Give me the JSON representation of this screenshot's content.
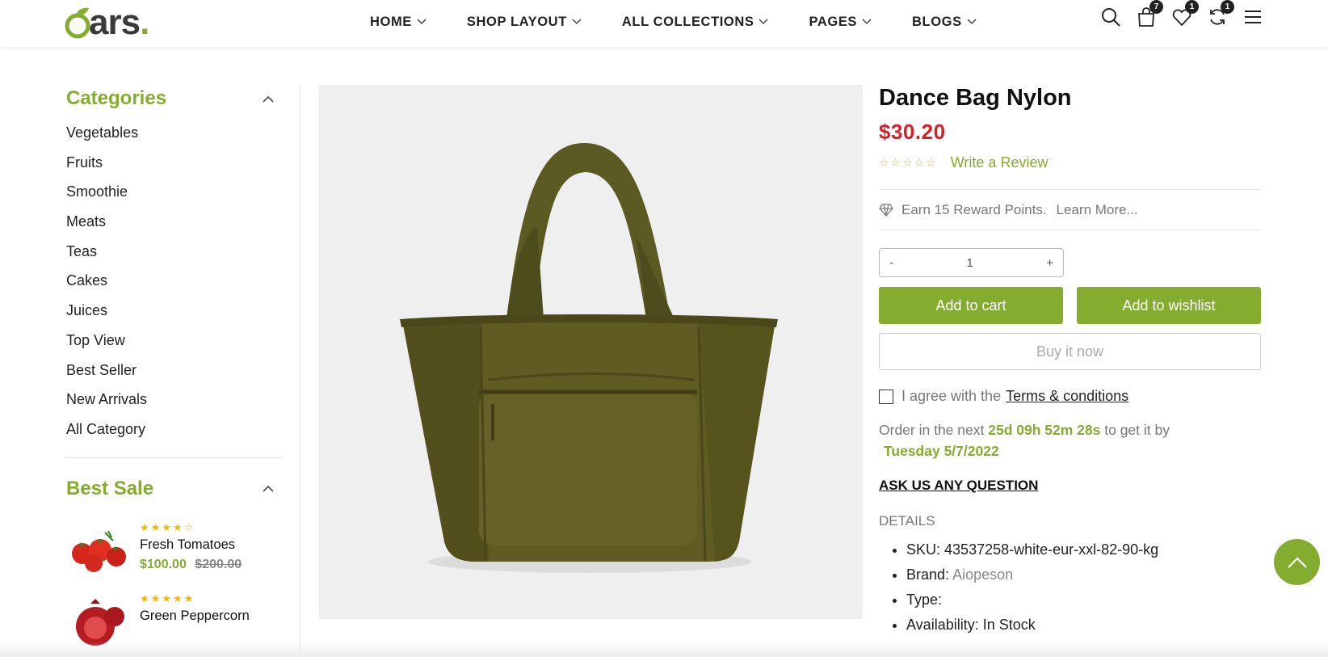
{
  "brand": {
    "logo_text": "ars",
    "logo_dot": ".",
    "accent": "#84ad2f"
  },
  "nav": [
    {
      "label": "HOME"
    },
    {
      "label": "SHOP LAYOUT"
    },
    {
      "label": "ALL COLLECTIONS"
    },
    {
      "label": "PAGES"
    },
    {
      "label": "BLOGS"
    }
  ],
  "header_icons": {
    "cart_count": "7",
    "wishlist_count": "1",
    "compare_count": "1"
  },
  "sidebar": {
    "categories_title": "Categories",
    "categories": [
      "Vegetables",
      "Fruits",
      "Smoothie",
      "Meats",
      "Teas",
      "Cakes",
      "Juices",
      "Top View",
      "Best Seller",
      "New Arrivals",
      "All Category"
    ],
    "best_sale_title": "Best Sale",
    "best_sale": [
      {
        "name": "Fresh Tomatoes",
        "stars": "★★★★☆",
        "rating": 4,
        "price": "$100.00",
        "old_price": "$200.00"
      },
      {
        "name": "Green Peppercorn",
        "stars": "★★★★★",
        "rating": 5
      }
    ]
  },
  "product": {
    "title": "Dance Bag Nylon",
    "price": "$30.20",
    "price_color": "#d91f26",
    "review_stars": "☆☆☆☆☆",
    "rating": 0,
    "review_link": "Write a Review",
    "reward_text": "Earn 15 Reward Points.",
    "learn_more": "Learn More...",
    "qty_minus": "-",
    "qty_value": "1",
    "qty_plus": "+",
    "add_to_cart": "Add to cart",
    "add_to_wishlist": "Add to wishlist",
    "buy_now": "Buy it now",
    "agree_text": "I agree with the",
    "terms_link": "Terms & conditions",
    "order_prefix": "Order in the next",
    "countdown": "25d 09h 52m 28s",
    "order_mid": "to get it by",
    "delivery_date": "Tuesday 5/7/2022",
    "ask_question": "ASK US ANY QUESTION",
    "details_heading": "DETAILS",
    "details": [
      {
        "label": "SKU:",
        "value": "43537258-white-eur-xxl-82-90-kg"
      },
      {
        "label": "Brand:",
        "value": "Aiopeson"
      },
      {
        "label": "Type:",
        "value": ""
      },
      {
        "label": "Availability:",
        "value": "In Stock"
      }
    ]
  }
}
